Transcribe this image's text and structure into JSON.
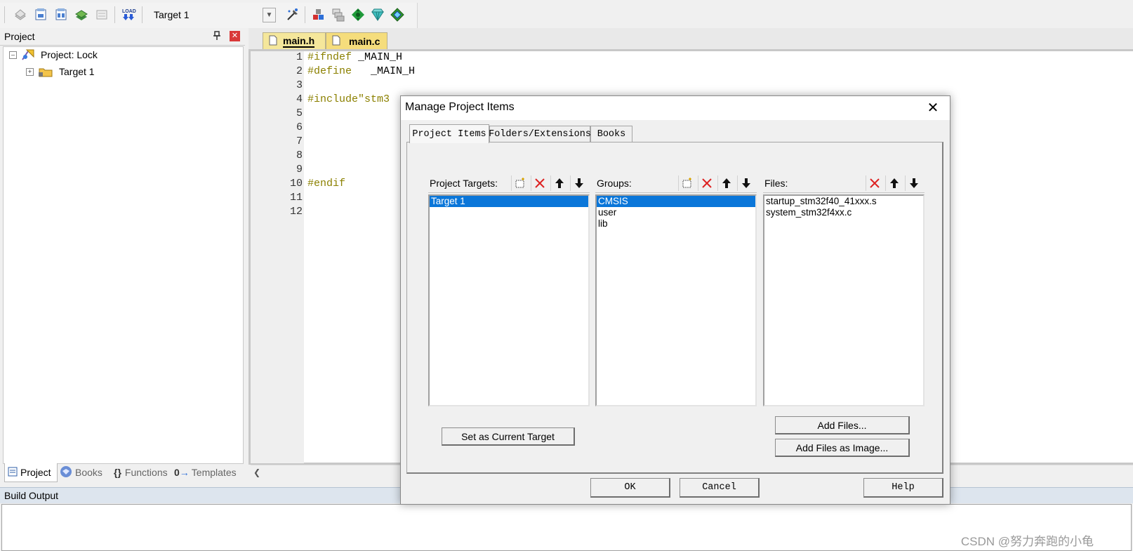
{
  "toolbar": {
    "target_select_value": "Target 1",
    "icons": [
      "translate-icon",
      "build-icon",
      "rebuild-icon",
      "batch-build-icon",
      "stop-build-icon",
      "download-icon",
      "target-options-icon",
      "file-extensions-icon",
      "select-packs-icon",
      "manage-run-time-icon",
      "pack-installer-icon",
      "start-debug-icon"
    ]
  },
  "project_panel": {
    "title": "Project",
    "tree": {
      "root_label": "Project: Lock",
      "child_label": "Target 1"
    },
    "bottom_tabs": [
      "Project",
      "Books",
      "Functions",
      "Templates"
    ]
  },
  "editor": {
    "tabs": [
      "main.h",
      "main.c"
    ],
    "line_numbers": [
      "1",
      "2",
      "3",
      "4",
      "5",
      "6",
      "7",
      "8",
      "9",
      "10",
      "11",
      "12"
    ],
    "lines": [
      {
        "kw": "#ifndef",
        "rest": " _MAIN_H"
      },
      {
        "kw": "#define",
        "rest": "   _MAIN_H"
      },
      {
        "kw": "",
        "rest": ""
      },
      {
        "kw": "#include",
        "rest": "\"stm3"
      },
      {
        "kw": "",
        "rest": ""
      },
      {
        "kw": "",
        "rest": ""
      },
      {
        "kw": "",
        "rest": ""
      },
      {
        "kw": "",
        "rest": ""
      },
      {
        "kw": "",
        "rest": ""
      },
      {
        "kw": "#endif",
        "rest": ""
      },
      {
        "kw": "",
        "rest": ""
      },
      {
        "kw": "",
        "rest": ""
      }
    ]
  },
  "build_output": {
    "title": "Build Output"
  },
  "watermark": "CSDN @努力奔跑的小龟",
  "dialog": {
    "title": "Manage Project Items",
    "tabs": [
      "Project Items",
      "Folders/Extensions",
      "Books"
    ],
    "targets": {
      "label": "Project Targets:",
      "items": [
        "Target 1"
      ],
      "selected": "Target 1"
    },
    "groups": {
      "label": "Groups:",
      "items": [
        "CMSIS",
        "user",
        "lib"
      ],
      "selected": "CMSIS"
    },
    "files": {
      "label": "Files:",
      "items": [
        "startup_stm32f40_41xxx.s",
        "system_stm32f4xx.c"
      ]
    },
    "buttons": {
      "set_current": "Set as Current Target",
      "add_files": "Add Files...",
      "add_files_image": "Add Files as Image...",
      "ok": "OK",
      "cancel": "Cancel",
      "help": "Help"
    }
  }
}
